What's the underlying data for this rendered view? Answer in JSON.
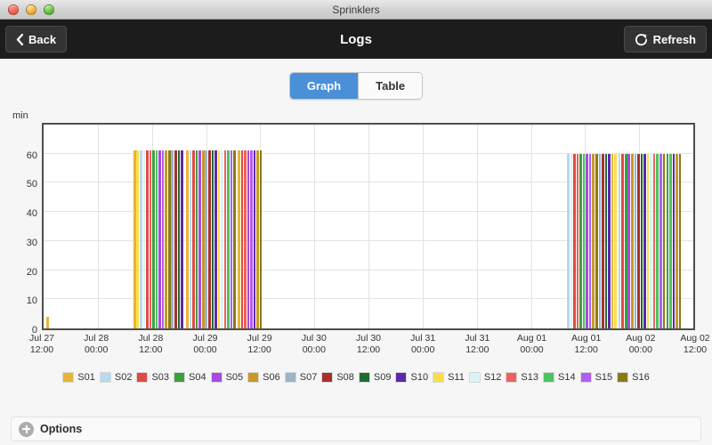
{
  "window": {
    "title": "Sprinklers",
    "controls": [
      "close",
      "minimize",
      "zoom"
    ]
  },
  "navbar": {
    "back_label": "Back",
    "title": "Logs",
    "refresh_label": "Refresh"
  },
  "view_switch": {
    "options": [
      "Graph",
      "Table"
    ],
    "selected": "Graph"
  },
  "options_bar": {
    "label": "Options"
  },
  "colors": {
    "accent": "#4a90d9",
    "navbar_bg": "#1c1c1c",
    "page_bg": "#f6f6f6",
    "plot_border": "#4e4e4a",
    "gridline": "#e3e3e3"
  },
  "chart_data": {
    "type": "bar",
    "title": "",
    "xlabel": "",
    "ylabel": "min",
    "ylim": [
      0,
      70
    ],
    "yticks": [
      0,
      10,
      20,
      30,
      40,
      50,
      60
    ],
    "grid": true,
    "legend_position": "bottom",
    "xtick_labels": [
      "Jul 27\n12:00",
      "Jul 28\n00:00",
      "Jul 28\n12:00",
      "Jul 29\n00:00",
      "Jul 29\n12:00",
      "Jul 30\n00:00",
      "Jul 30\n12:00",
      "Jul 31\n00:00",
      "Jul 31\n12:00",
      "Aug 01\n00:00",
      "Aug 01\n12:00",
      "Aug 02\n00:00",
      "Aug 02\n12:00"
    ],
    "xlim_hours": [
      0,
      144
    ],
    "series": [
      {
        "name": "S01",
        "color": "#e8b33a"
      },
      {
        "name": "S02",
        "color": "#b8d9f0"
      },
      {
        "name": "S03",
        "color": "#e04a43"
      },
      {
        "name": "S04",
        "color": "#3f9e3f"
      },
      {
        "name": "S05",
        "color": "#a94ae0"
      },
      {
        "name": "S06",
        "color": "#c79a28"
      },
      {
        "name": "S07",
        "color": "#98b5cc"
      },
      {
        "name": "S08",
        "color": "#a82f2f"
      },
      {
        "name": "S09",
        "color": "#1f6b2e"
      },
      {
        "name": "S10",
        "color": "#5b2aa8"
      },
      {
        "name": "S11",
        "color": "#f7df4a"
      },
      {
        "name": "S12",
        "color": "#dbf4f7"
      },
      {
        "name": "S13",
        "color": "#f0615b"
      },
      {
        "name": "S14",
        "color": "#4cc45f"
      },
      {
        "name": "S15",
        "color": "#b05ef0"
      },
      {
        "name": "S16",
        "color": "#8a7a16"
      }
    ],
    "events": [
      {
        "hour": 0.6,
        "duration": 4,
        "series": 0
      },
      {
        "hour": 20.0,
        "duration": 61,
        "series": 0
      },
      {
        "hour": 20.6,
        "duration": 61,
        "series": 10
      },
      {
        "hour": 21.4,
        "duration": 61,
        "series": 1
      },
      {
        "hour": 22.0,
        "duration": 61,
        "series": 11
      },
      {
        "hour": 22.7,
        "duration": 61,
        "series": 2
      },
      {
        "hour": 23.4,
        "duration": 61,
        "series": 12
      },
      {
        "hour": 24.1,
        "duration": 61,
        "series": 3
      },
      {
        "hour": 24.8,
        "duration": 61,
        "series": 13
      },
      {
        "hour": 25.5,
        "duration": 61,
        "series": 4
      },
      {
        "hour": 26.2,
        "duration": 61,
        "series": 14
      },
      {
        "hour": 26.9,
        "duration": 61,
        "series": 5
      },
      {
        "hour": 27.6,
        "duration": 61,
        "series": 15
      },
      {
        "hour": 28.3,
        "duration": 61,
        "series": 6
      },
      {
        "hour": 29.0,
        "duration": 61,
        "series": 7
      },
      {
        "hour": 29.7,
        "duration": 61,
        "series": 8
      },
      {
        "hour": 30.4,
        "duration": 61,
        "series": 9
      },
      {
        "hour": 31.6,
        "duration": 61,
        "series": 0
      },
      {
        "hour": 32.3,
        "duration": 61,
        "series": 1
      },
      {
        "hour": 33.0,
        "duration": 61,
        "series": 2
      },
      {
        "hour": 33.7,
        "duration": 61,
        "series": 3
      },
      {
        "hour": 34.4,
        "duration": 61,
        "series": 4
      },
      {
        "hour": 35.1,
        "duration": 61,
        "series": 5
      },
      {
        "hour": 35.8,
        "duration": 61,
        "series": 6
      },
      {
        "hour": 36.5,
        "duration": 61,
        "series": 7
      },
      {
        "hour": 37.2,
        "duration": 61,
        "series": 8
      },
      {
        "hour": 37.9,
        "duration": 61,
        "series": 9
      },
      {
        "hour": 38.6,
        "duration": 61,
        "series": 10
      },
      {
        "hour": 39.3,
        "duration": 61,
        "series": 11
      },
      {
        "hour": 40.0,
        "duration": 61,
        "series": 12
      },
      {
        "hour": 40.7,
        "duration": 61,
        "series": 13
      },
      {
        "hour": 41.4,
        "duration": 61,
        "series": 14
      },
      {
        "hour": 42.1,
        "duration": 61,
        "series": 15
      },
      {
        "hour": 43.0,
        "duration": 61,
        "series": 0
      },
      {
        "hour": 43.7,
        "duration": 61,
        "series": 2
      },
      {
        "hour": 44.4,
        "duration": 61,
        "series": 12
      },
      {
        "hour": 45.1,
        "duration": 61,
        "series": 4
      },
      {
        "hour": 45.8,
        "duration": 61,
        "series": 14
      },
      {
        "hour": 46.5,
        "duration": 61,
        "series": 9
      },
      {
        "hour": 47.2,
        "duration": 61,
        "series": 5
      },
      {
        "hour": 47.9,
        "duration": 61,
        "series": 15
      },
      {
        "hour": 116.0,
        "duration": 60,
        "series": 1
      },
      {
        "hour": 116.7,
        "duration": 60,
        "series": 11
      },
      {
        "hour": 117.4,
        "duration": 60,
        "series": 2
      },
      {
        "hour": 118.1,
        "duration": 60,
        "series": 12
      },
      {
        "hour": 118.8,
        "duration": 60,
        "series": 3
      },
      {
        "hour": 119.5,
        "duration": 60,
        "series": 13
      },
      {
        "hour": 120.2,
        "duration": 60,
        "series": 4
      },
      {
        "hour": 120.9,
        "duration": 60,
        "series": 14
      },
      {
        "hour": 121.6,
        "duration": 60,
        "series": 5
      },
      {
        "hour": 122.3,
        "duration": 60,
        "series": 15
      },
      {
        "hour": 123.0,
        "duration": 60,
        "series": 6
      },
      {
        "hour": 123.7,
        "duration": 60,
        "series": 7
      },
      {
        "hour": 124.4,
        "duration": 60,
        "series": 8
      },
      {
        "hour": 125.1,
        "duration": 60,
        "series": 9
      },
      {
        "hour": 125.8,
        "duration": 60,
        "series": 0
      },
      {
        "hour": 126.5,
        "duration": 60,
        "series": 10
      },
      {
        "hour": 127.4,
        "duration": 60,
        "series": 1
      },
      {
        "hour": 128.1,
        "duration": 60,
        "series": 2
      },
      {
        "hour": 128.8,
        "duration": 60,
        "series": 3
      },
      {
        "hour": 129.5,
        "duration": 60,
        "series": 4
      },
      {
        "hour": 130.2,
        "duration": 60,
        "series": 5
      },
      {
        "hour": 130.9,
        "duration": 60,
        "series": 6
      },
      {
        "hour": 131.6,
        "duration": 60,
        "series": 7
      },
      {
        "hour": 132.3,
        "duration": 60,
        "series": 8
      },
      {
        "hour": 133.0,
        "duration": 60,
        "series": 9
      },
      {
        "hour": 133.7,
        "duration": 60,
        "series": 10
      },
      {
        "hour": 134.4,
        "duration": 60,
        "series": 11
      },
      {
        "hour": 135.1,
        "duration": 60,
        "series": 12
      },
      {
        "hour": 135.8,
        "duration": 60,
        "series": 13
      },
      {
        "hour": 136.5,
        "duration": 60,
        "series": 14
      },
      {
        "hour": 137.2,
        "duration": 60,
        "series": 15
      },
      {
        "hour": 138.0,
        "duration": 60,
        "series": 3
      },
      {
        "hour": 138.7,
        "duration": 60,
        "series": 13
      },
      {
        "hour": 139.4,
        "duration": 60,
        "series": 9
      },
      {
        "hour": 140.1,
        "duration": 60,
        "series": 5
      },
      {
        "hour": 140.8,
        "duration": 60,
        "series": 15
      }
    ]
  }
}
